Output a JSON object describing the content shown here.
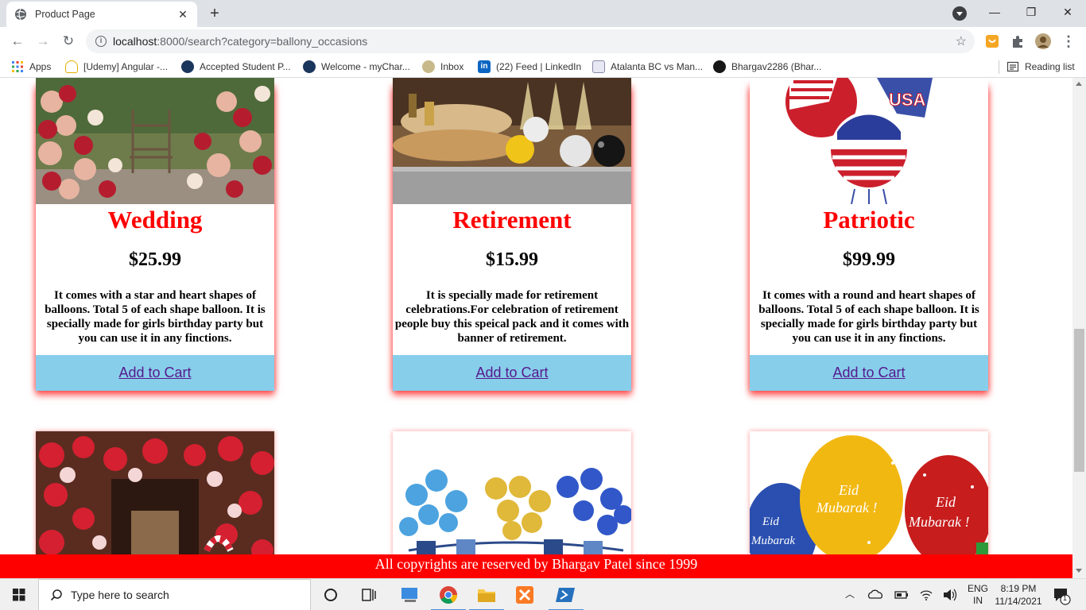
{
  "browser": {
    "tab_title": "Product Page",
    "url_host": "localhost",
    "url_rest": ":8000/search?category=ballony_occasions",
    "reading_list": "Reading list",
    "bookmarks": [
      {
        "label": "Apps",
        "icon": "apps-grid-icon"
      },
      {
        "label": "[Udemy] Angular -...",
        "icon": "udemy-icon"
      },
      {
        "label": "Accepted Student P...",
        "icon": "university-icon"
      },
      {
        "label": "Welcome - myChar...",
        "icon": "university-icon"
      },
      {
        "label": "Inbox",
        "icon": "mail-icon"
      },
      {
        "label": "(22) Feed | LinkedIn",
        "icon": "linkedin-icon"
      },
      {
        "label": "Atalanta BC vs Man...",
        "icon": "soccer-icon"
      },
      {
        "label": "Bhargav2286 (Bhar...",
        "icon": "github-icon"
      }
    ]
  },
  "products": [
    {
      "name": "Wedding",
      "price": "$25.99",
      "description": "It comes with a star and heart shapes of balloons. Total 5 of each shape balloon. It is specially made for girls birthday party but you can use it in any finctions.",
      "cta": "Add to Cart"
    },
    {
      "name": "Retirement",
      "price": "$15.99",
      "description": "It is specially made for retirement celebrations.For celebration of retirement people buy this speical pack and it comes with banner of retirement.",
      "cta": "Add to Cart"
    },
    {
      "name": "Patriotic",
      "price": "$99.99",
      "description": "It comes with a round and heart shapes of balloons. Total 5 of each shape balloon. It is specially made for girls birthday party but you can use it in any finctions.",
      "cta": "Add to Cart"
    }
  ],
  "footer": "All copyrights are reserved by Bhargav Patel since 1999",
  "taskbar": {
    "search_placeholder": "Type here to search",
    "lang_top": "ENG",
    "lang_bottom": "IN",
    "time": "8:19 PM",
    "date": "11/14/2021",
    "notification_count": "1"
  },
  "colors": {
    "accent": "#ff0000",
    "cart_bg": "#87ceeb",
    "link": "#551a8b"
  }
}
